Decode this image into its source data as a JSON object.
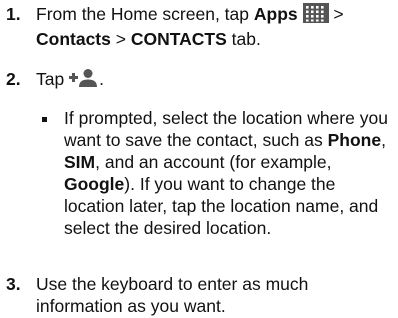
{
  "steps": [
    {
      "number": "1.",
      "t1": "From the Home screen, tap ",
      "apps": "Apps",
      "t2": " > ",
      "contacts": "Contacts",
      "t3": " > ",
      "contacts_tab": "CONTACTS",
      "t4": " tab."
    },
    {
      "number": "2.",
      "t1": "Tap ",
      "t2": "."
    },
    {
      "number": "3.",
      "text": "Use the keyboard to enter as much information as you want."
    }
  ],
  "bullet": {
    "t1": "If prompted, select the location where you want to save the contact, such as ",
    "phone": "Phone",
    "t2": ", ",
    "sim": "SIM",
    "t3": ", and an account (for example, ",
    "google": "Google",
    "t4": "). If you want to change the location later, tap the location name, and select the desired location."
  },
  "icons": {
    "apps": "apps-grid-icon",
    "add_contact": "add-contact-icon"
  },
  "colors": {
    "text": "#111111",
    "icon_bg": "#555555"
  }
}
